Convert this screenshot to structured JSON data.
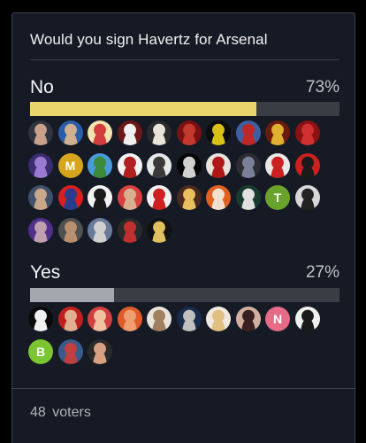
{
  "poll": {
    "title": "Would you sign Havertz for Arsenal",
    "voters_count": "48",
    "voters_label": "voters"
  },
  "options": [
    {
      "label": "No",
      "percent_text": "73%",
      "percent": 73,
      "bar_color": "#e9d56c",
      "avatars": [
        {
          "kind": "photo",
          "c1": "#30343e",
          "c2": "#c9a08a"
        },
        {
          "kind": "photo",
          "c1": "#2a5ea8",
          "c2": "#d0b090"
        },
        {
          "kind": "photo",
          "c1": "#f3e3b0",
          "c2": "#d23c3c"
        },
        {
          "kind": "photo",
          "c1": "#6c1818",
          "c2": "#f0f0f0"
        },
        {
          "kind": "photo",
          "c1": "#2b2b2b",
          "c2": "#e8e4da"
        },
        {
          "kind": "photo",
          "c1": "#7a1111",
          "c2": "#c23a2e"
        },
        {
          "kind": "photo",
          "c1": "#0c0c0c",
          "c2": "#d8c21a"
        },
        {
          "kind": "photo",
          "c1": "#3f5fa0",
          "c2": "#c02828"
        },
        {
          "kind": "photo",
          "c1": "#6b1a10",
          "c2": "#e2b030"
        },
        {
          "kind": "photo",
          "c1": "#8a1212",
          "c2": "#d03030"
        },
        {
          "kind": "photo",
          "c1": "#3a2c6e",
          "c2": "#9a7ad0"
        },
        {
          "kind": "letter",
          "text": "M",
          "bg": "#d6a51d"
        },
        {
          "kind": "photo",
          "c1": "#4a9ad8",
          "c2": "#3a8a3a"
        },
        {
          "kind": "photo",
          "c1": "#f2f2f2",
          "c2": "#b02020"
        },
        {
          "kind": "photo",
          "c1": "#e8e8e8",
          "c2": "#3a3a3a"
        },
        {
          "kind": "photo",
          "c1": "#050505",
          "c2": "#d0d0d0"
        },
        {
          "kind": "photo",
          "c1": "#e8e2dc",
          "c2": "#b01818"
        },
        {
          "kind": "photo",
          "c1": "#2c2c34",
          "c2": "#7a8098"
        },
        {
          "kind": "photo",
          "c1": "#e8e8e8",
          "c2": "#cc1f1f"
        },
        {
          "kind": "photo",
          "c1": "#cc2020",
          "c2": "#1a1a1a"
        },
        {
          "kind": "photo",
          "c1": "#40506a",
          "c2": "#c8a888"
        },
        {
          "kind": "photo",
          "c1": "#d82020",
          "c2": "#2a3c8a"
        },
        {
          "kind": "photo",
          "c1": "#f2f2f2",
          "c2": "#1a1a1a"
        },
        {
          "kind": "photo",
          "c1": "#d84040",
          "c2": "#d8b090"
        },
        {
          "kind": "photo",
          "c1": "#f0f0f0",
          "c2": "#cc1f1f"
        },
        {
          "kind": "photo",
          "c1": "#4a2a20",
          "c2": "#e8c060"
        },
        {
          "kind": "photo",
          "c1": "#e06020",
          "c2": "#f0e0d0"
        },
        {
          "kind": "photo",
          "c1": "#1a3a30",
          "c2": "#e0e0e0"
        },
        {
          "kind": "letter",
          "text": "T",
          "bg": "#6aa32c"
        },
        {
          "kind": "photo",
          "c1": "#d8d8d8",
          "c2": "#222222"
        },
        {
          "kind": "photo",
          "c1": "#50308a",
          "c2": "#c0a0b0"
        },
        {
          "kind": "photo",
          "c1": "#505050",
          "c2": "#b89070"
        },
        {
          "kind": "photo",
          "c1": "#6a7a9a",
          "c2": "#d0d0d0"
        },
        {
          "kind": "photo",
          "c1": "#2a2a2a",
          "c2": "#c03030"
        },
        {
          "kind": "photo",
          "c1": "#111111",
          "c2": "#e0c060"
        }
      ]
    },
    {
      "label": "Yes",
      "percent_text": "27%",
      "percent": 27,
      "bar_color": "#a4a7ad",
      "avatars": [
        {
          "kind": "photo",
          "c1": "#0a0a0a",
          "c2": "#f0f0f0"
        },
        {
          "kind": "photo",
          "c1": "#c02020",
          "c2": "#e0b090"
        },
        {
          "kind": "photo",
          "c1": "#d04040",
          "c2": "#f0c0a0"
        },
        {
          "kind": "photo",
          "c1": "#e05a2a",
          "c2": "#f0a070"
        },
        {
          "kind": "photo",
          "c1": "#e8e4dc",
          "c2": "#a08060"
        },
        {
          "kind": "photo",
          "c1": "#1a2a4a",
          "c2": "#c0c0c0"
        },
        {
          "kind": "photo",
          "c1": "#f0e8e0",
          "c2": "#e0c080"
        },
        {
          "kind": "photo",
          "c1": "#d0b0a0",
          "c2": "#3a2020"
        },
        {
          "kind": "letter",
          "text": "N",
          "bg": "#e56b87"
        },
        {
          "kind": "photo",
          "c1": "#f0f0f0",
          "c2": "#1a1a1a"
        },
        {
          "kind": "letter",
          "text": "B",
          "bg": "#7bc531"
        },
        {
          "kind": "photo",
          "c1": "#3a5a8a",
          "c2": "#c04040"
        },
        {
          "kind": "photo",
          "c1": "#2a2a2a",
          "c2": "#d8a080"
        }
      ]
    }
  ]
}
